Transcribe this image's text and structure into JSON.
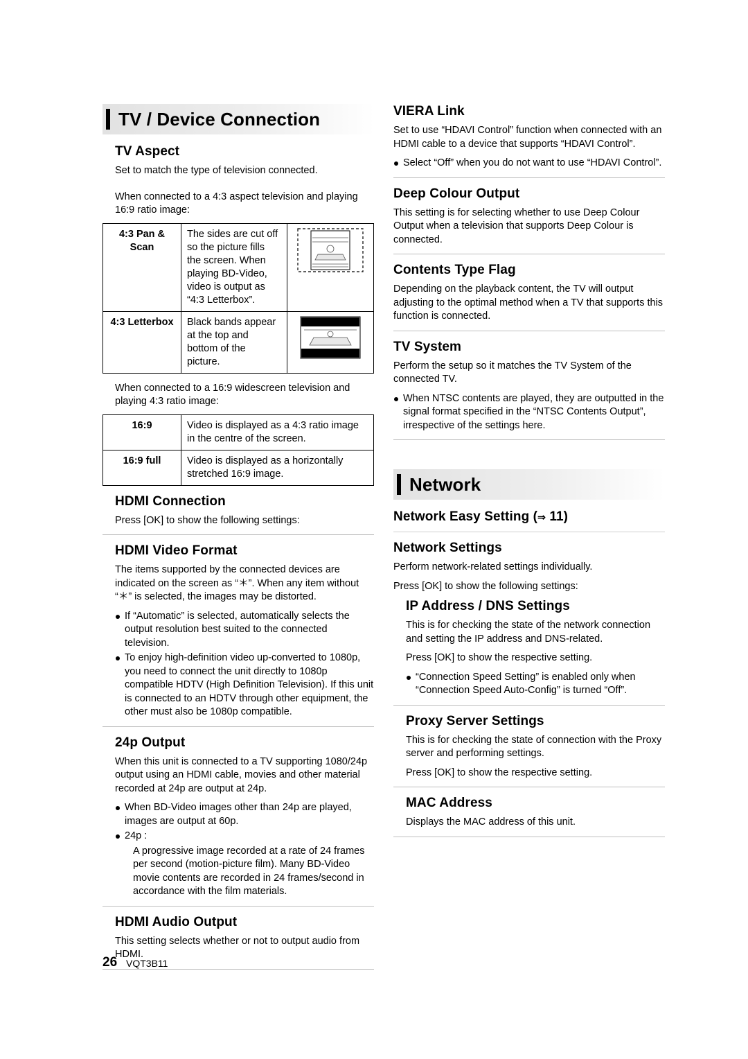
{
  "page": {
    "number": "26",
    "code": "VQT3B11"
  },
  "sections": {
    "tv": {
      "banner_title": "TV / Device Connection",
      "tv_aspect": {
        "heading": "TV Aspect",
        "p1": "Set to match the type of television connected.",
        "p2": "When connected to a 4:3 aspect television and playing 16:9 ratio image:",
        "table43": [
          {
            "label": "4:3 Pan & Scan",
            "desc": "The sides are cut off so the picture fills the screen. When playing BD-Video, video is output as “4:3 Letterbox”.",
            "image": "tv-panscan-image"
          },
          {
            "label": "4:3 Letterbox",
            "desc": "Black bands appear at the top and bottom of the picture.",
            "image": "tv-letterbox-image"
          }
        ],
        "p3": "When connected to a 16:9 widescreen television and playing 4:3 ratio image:",
        "table169": [
          {
            "label": "16:9",
            "desc": "Video is displayed as a 4:3 ratio image in the centre of the screen."
          },
          {
            "label": "16:9 full",
            "desc": "Video is displayed as a horizontally stretched 16:9 image."
          }
        ]
      },
      "hdmi_connection": {
        "heading": "HDMI Connection",
        "p1": "Press [OK] to show the following settings:"
      },
      "hdmi_video_format": {
        "heading": "HDMI Video Format",
        "p1": "The items supported by the connected devices are indicated on the screen as “＊”. When any item without “＊” is selected, the images may be distorted.",
        "bullets": [
          "If “Automatic” is selected, automatically selects the output resolution best suited to the connected television.",
          "To enjoy high-definition video up-converted to 1080p, you need to connect the unit directly to 1080p compatible HDTV (High Definition Television). If this unit is connected to an HDTV through other equipment, the other must also be 1080p compatible."
        ]
      },
      "output_24p": {
        "heading": "24p Output",
        "p1": "When this unit is connected to a TV supporting 1080/24p output using an HDMI cable, movies and other material recorded at 24p are output at 24p.",
        "bullets": [
          "When BD-Video images other than 24p are played, images are output at 60p.",
          "24p :"
        ],
        "sub": "A progressive image recorded at a rate of 24 frames per second (motion-picture film). Many BD-Video movie contents are recorded in 24 frames/second in accordance with the film materials."
      },
      "hdmi_audio_output": {
        "heading": "HDMI Audio Output",
        "p1": "This setting selects whether or not to output audio from HDMI."
      },
      "viera_link": {
        "heading": "VIERA Link",
        "p1": "Set to use “HDAVI Control” function when connected with an HDMI cable to a device that supports “HDAVI Control”.",
        "bullets": [
          "Select “Off” when you do not want to use “HDAVI Control”."
        ]
      },
      "deep_colour": {
        "heading": "Deep Colour Output",
        "p1": "This setting is for selecting whether to use Deep Colour Output when a television that supports Deep Colour is connected."
      },
      "contents_type_flag": {
        "heading": "Contents Type Flag",
        "p1": "Depending on the playback content, the TV will output adjusting to the optimal method when a TV that supports this function is connected."
      },
      "tv_system": {
        "heading": "TV System",
        "p1": "Perform the setup so it matches the TV System of the connected TV.",
        "bullets": [
          "When NTSC contents are played, they are outputted in the signal format specified in the “NTSC Contents Output”, irrespective of the settings here."
        ]
      }
    },
    "network": {
      "banner_title": "Network",
      "easy_setting": {
        "heading": "Network Easy Setting (",
        "arrow": "⇒",
        "page_ref": "11)"
      },
      "network_settings": {
        "heading": "Network Settings",
        "p1": "Perform network-related settings individually.",
        "p2": "Press [OK] to show the following settings:"
      },
      "ip_dns": {
        "heading": "IP Address / DNS Settings",
        "p1": "This is for checking the state of the network connection and setting the IP address and DNS-related.",
        "p2": "Press [OK] to show the respective setting.",
        "bullets": [
          "“Connection Speed Setting” is enabled only when “Connection Speed Auto-Config” is turned “Off”."
        ]
      },
      "proxy": {
        "heading": "Proxy Server Settings",
        "p1": "This is for checking the state of connection with the Proxy server and performing settings.",
        "p2": "Press [OK] to show the respective setting."
      },
      "mac": {
        "heading": "MAC Address",
        "p1": "Displays the MAC address of this unit."
      }
    }
  }
}
